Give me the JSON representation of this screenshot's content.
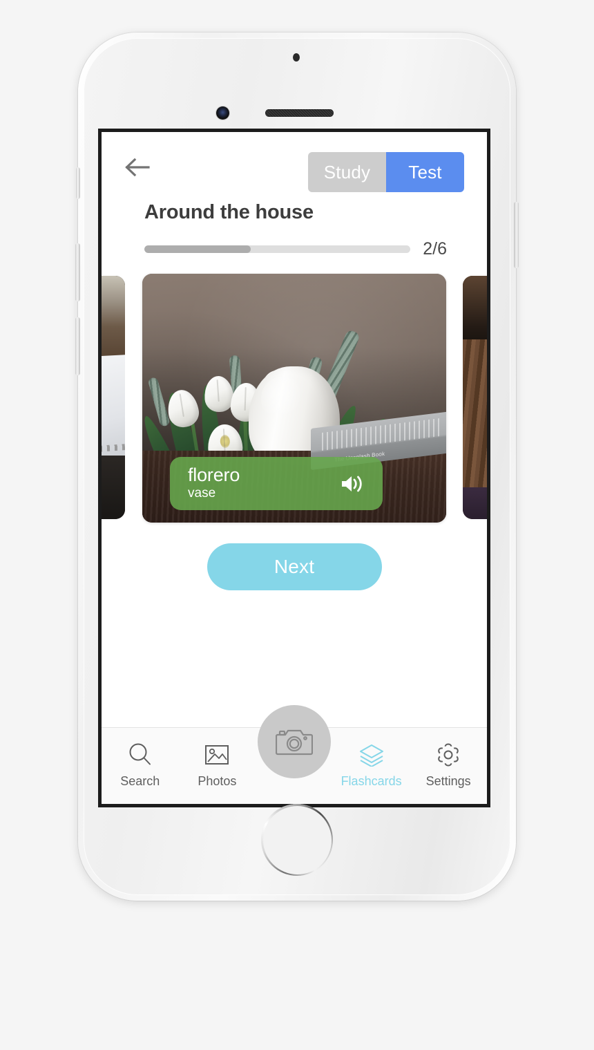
{
  "app": {
    "screen_name": "Flashcards Test",
    "accent_color": "#85d6e8",
    "active_segment_color": "#5b8def",
    "word_pill_color": "#68a94d"
  },
  "header": {
    "back_icon": "arrow-left-icon",
    "modes": [
      {
        "label": "Study",
        "active": false
      },
      {
        "label": "Test",
        "active": true
      }
    ]
  },
  "deck": {
    "title": "Around the house",
    "progress_label": "2/6",
    "current": 2,
    "total": 6,
    "progress_percent": 40
  },
  "card": {
    "word": "florero",
    "translation": "vase",
    "speaker_icon": "speaker-wave-icon",
    "photo_alt": "White tulips in a white ceramic vase on a wooden table",
    "photo_book_label": "The Unsplash Book"
  },
  "actions": {
    "next_label": "Next"
  },
  "tabbar": {
    "items": [
      {
        "label": "Search",
        "icon": "search-icon",
        "active": false
      },
      {
        "label": "Photos",
        "icon": "photo-icon",
        "active": false
      },
      {
        "label": "Flashcards",
        "icon": "layers-icon",
        "active": true
      },
      {
        "label": "Settings",
        "icon": "gear-icon",
        "active": false
      }
    ],
    "camera_button": {
      "icon": "camera-icon",
      "label": ""
    }
  }
}
